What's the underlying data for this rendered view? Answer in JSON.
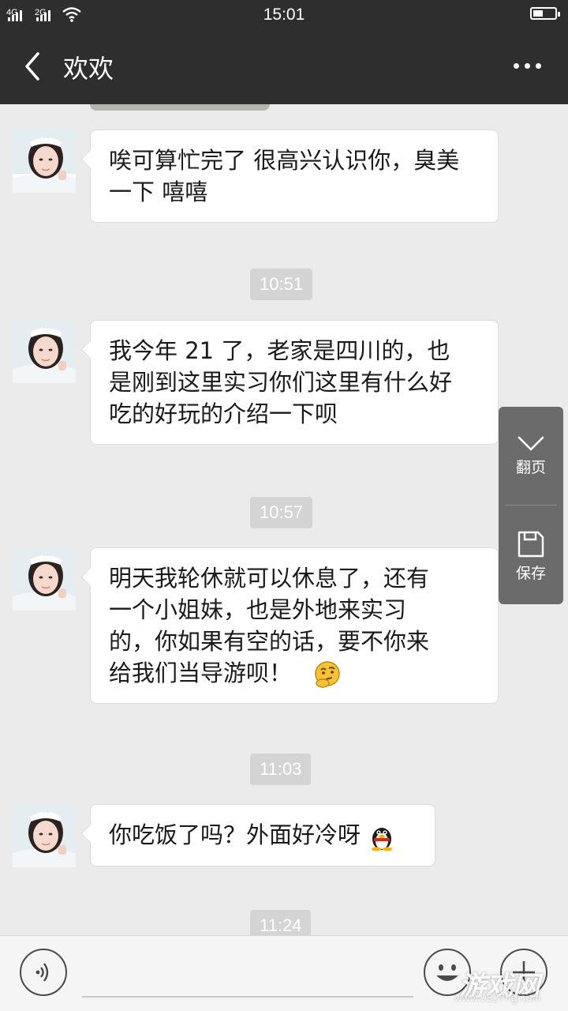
{
  "status_bar": {
    "sim1": "4G",
    "sim2": "2G",
    "time": "15:01",
    "icons": [
      "signal-icon",
      "wifi-icon",
      "battery-icon"
    ]
  },
  "header": {
    "title": "欢欢",
    "back_icon": "chevron-left-icon",
    "menu_icon": "more-icon"
  },
  "messages": [
    {
      "text_lines": [
        "唉可算忙完了 很高兴认识你，臭美",
        "一下 嘻嘻"
      ]
    },
    {
      "timestamp": "10:51",
      "text_lines": [
        "我今年 21 了，老家是四川的，也",
        "是刚到这里实习你们这里有什么好",
        "吃的好玩的介绍一下呗"
      ]
    },
    {
      "timestamp": "10:57",
      "text_lines": [
        "明天我轮休就可以休息了，还有",
        "一个小姐妹，也是外地来实习",
        "的，你如果有空的话，要不你来",
        "给我们当导游呗！"
      ],
      "emoji": "thinking-emoji-icon"
    },
    {
      "timestamp": "11:03",
      "text_lines": [
        "你吃饭了吗？外面好冷呀"
      ],
      "emoji": "penguin-emoji-icon"
    },
    {
      "timestamp": "11:24"
    }
  ],
  "floating_panel": {
    "page_label": "翻页",
    "save_label": "保存"
  },
  "bottom_bar": {
    "voice_icon": "voice-icon",
    "emoji_icon": "smile-icon",
    "plus_icon": "plus-icon"
  },
  "watermark": {
    "text": "游戏网",
    "url": "www.0827hg.com"
  },
  "colors": {
    "bar": "#2e2e2e",
    "chat_bg": "#ebebeb",
    "bubble": "#ffffff",
    "timestamp_bg": "#d4d4d4",
    "panel": "#6b6b6b"
  }
}
